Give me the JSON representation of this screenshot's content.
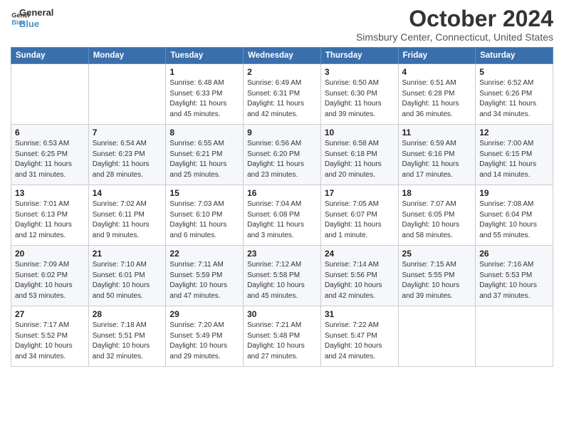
{
  "header": {
    "logo_line1": "General",
    "logo_line2": "Blue",
    "month_title": "October 2024",
    "location": "Simsbury Center, Connecticut, United States"
  },
  "days_of_week": [
    "Sunday",
    "Monday",
    "Tuesday",
    "Wednesday",
    "Thursday",
    "Friday",
    "Saturday"
  ],
  "weeks": [
    [
      {
        "day": "",
        "detail": ""
      },
      {
        "day": "",
        "detail": ""
      },
      {
        "day": "1",
        "detail": "Sunrise: 6:48 AM\nSunset: 6:33 PM\nDaylight: 11 hours and 45 minutes."
      },
      {
        "day": "2",
        "detail": "Sunrise: 6:49 AM\nSunset: 6:31 PM\nDaylight: 11 hours and 42 minutes."
      },
      {
        "day": "3",
        "detail": "Sunrise: 6:50 AM\nSunset: 6:30 PM\nDaylight: 11 hours and 39 minutes."
      },
      {
        "day": "4",
        "detail": "Sunrise: 6:51 AM\nSunset: 6:28 PM\nDaylight: 11 hours and 36 minutes."
      },
      {
        "day": "5",
        "detail": "Sunrise: 6:52 AM\nSunset: 6:26 PM\nDaylight: 11 hours and 34 minutes."
      }
    ],
    [
      {
        "day": "6",
        "detail": "Sunrise: 6:53 AM\nSunset: 6:25 PM\nDaylight: 11 hours and 31 minutes."
      },
      {
        "day": "7",
        "detail": "Sunrise: 6:54 AM\nSunset: 6:23 PM\nDaylight: 11 hours and 28 minutes."
      },
      {
        "day": "8",
        "detail": "Sunrise: 6:55 AM\nSunset: 6:21 PM\nDaylight: 11 hours and 25 minutes."
      },
      {
        "day": "9",
        "detail": "Sunrise: 6:56 AM\nSunset: 6:20 PM\nDaylight: 11 hours and 23 minutes."
      },
      {
        "day": "10",
        "detail": "Sunrise: 6:58 AM\nSunset: 6:18 PM\nDaylight: 11 hours and 20 minutes."
      },
      {
        "day": "11",
        "detail": "Sunrise: 6:59 AM\nSunset: 6:16 PM\nDaylight: 11 hours and 17 minutes."
      },
      {
        "day": "12",
        "detail": "Sunrise: 7:00 AM\nSunset: 6:15 PM\nDaylight: 11 hours and 14 minutes."
      }
    ],
    [
      {
        "day": "13",
        "detail": "Sunrise: 7:01 AM\nSunset: 6:13 PM\nDaylight: 11 hours and 12 minutes."
      },
      {
        "day": "14",
        "detail": "Sunrise: 7:02 AM\nSunset: 6:11 PM\nDaylight: 11 hours and 9 minutes."
      },
      {
        "day": "15",
        "detail": "Sunrise: 7:03 AM\nSunset: 6:10 PM\nDaylight: 11 hours and 6 minutes."
      },
      {
        "day": "16",
        "detail": "Sunrise: 7:04 AM\nSunset: 6:08 PM\nDaylight: 11 hours and 3 minutes."
      },
      {
        "day": "17",
        "detail": "Sunrise: 7:05 AM\nSunset: 6:07 PM\nDaylight: 11 hours and 1 minute."
      },
      {
        "day": "18",
        "detail": "Sunrise: 7:07 AM\nSunset: 6:05 PM\nDaylight: 10 hours and 58 minutes."
      },
      {
        "day": "19",
        "detail": "Sunrise: 7:08 AM\nSunset: 6:04 PM\nDaylight: 10 hours and 55 minutes."
      }
    ],
    [
      {
        "day": "20",
        "detail": "Sunrise: 7:09 AM\nSunset: 6:02 PM\nDaylight: 10 hours and 53 minutes."
      },
      {
        "day": "21",
        "detail": "Sunrise: 7:10 AM\nSunset: 6:01 PM\nDaylight: 10 hours and 50 minutes."
      },
      {
        "day": "22",
        "detail": "Sunrise: 7:11 AM\nSunset: 5:59 PM\nDaylight: 10 hours and 47 minutes."
      },
      {
        "day": "23",
        "detail": "Sunrise: 7:12 AM\nSunset: 5:58 PM\nDaylight: 10 hours and 45 minutes."
      },
      {
        "day": "24",
        "detail": "Sunrise: 7:14 AM\nSunset: 5:56 PM\nDaylight: 10 hours and 42 minutes."
      },
      {
        "day": "25",
        "detail": "Sunrise: 7:15 AM\nSunset: 5:55 PM\nDaylight: 10 hours and 39 minutes."
      },
      {
        "day": "26",
        "detail": "Sunrise: 7:16 AM\nSunset: 5:53 PM\nDaylight: 10 hours and 37 minutes."
      }
    ],
    [
      {
        "day": "27",
        "detail": "Sunrise: 7:17 AM\nSunset: 5:52 PM\nDaylight: 10 hours and 34 minutes."
      },
      {
        "day": "28",
        "detail": "Sunrise: 7:18 AM\nSunset: 5:51 PM\nDaylight: 10 hours and 32 minutes."
      },
      {
        "day": "29",
        "detail": "Sunrise: 7:20 AM\nSunset: 5:49 PM\nDaylight: 10 hours and 29 minutes."
      },
      {
        "day": "30",
        "detail": "Sunrise: 7:21 AM\nSunset: 5:48 PM\nDaylight: 10 hours and 27 minutes."
      },
      {
        "day": "31",
        "detail": "Sunrise: 7:22 AM\nSunset: 5:47 PM\nDaylight: 10 hours and 24 minutes."
      },
      {
        "day": "",
        "detail": ""
      },
      {
        "day": "",
        "detail": ""
      }
    ]
  ]
}
